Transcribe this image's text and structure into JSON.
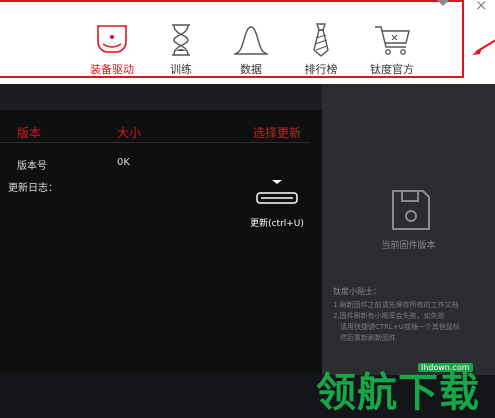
{
  "nav": [
    {
      "label": "装备驱动",
      "icon": "mouse-icon",
      "active": true
    },
    {
      "label": "训练",
      "icon": "hourglass-icon",
      "active": false
    },
    {
      "label": "数据",
      "icon": "chart-curve-icon",
      "active": false
    },
    {
      "label": "排行榜",
      "icon": "tie-icon",
      "active": false
    },
    {
      "label": "钛度官方",
      "icon": "cart-icon",
      "active": false
    }
  ],
  "window": {
    "close": "×"
  },
  "table": {
    "headers": {
      "version": "版本",
      "size": "大小",
      "select": "选择更新"
    },
    "version_label": "版本号",
    "size_value": "0K",
    "changelog_label": "更新日志："
  },
  "update_button": {
    "label": "更新(ctrl+U)"
  },
  "firmware": {
    "label": "当前固件版本"
  },
  "tips": {
    "title": "钛度小贴士：",
    "lines": [
      "1.刷新固件之前请先保存所有的工作文档",
      "2.固件刷新有小概率会失败，如失败",
      "  请用快捷键CTRL+U或插一个其他鼠标",
      "  然后重新刷新固件"
    ]
  },
  "watermark": {
    "text": "领航下载",
    "url": "lhdown.com"
  },
  "colors": {
    "accent": "#e0141e",
    "watermark": "#17a648"
  }
}
